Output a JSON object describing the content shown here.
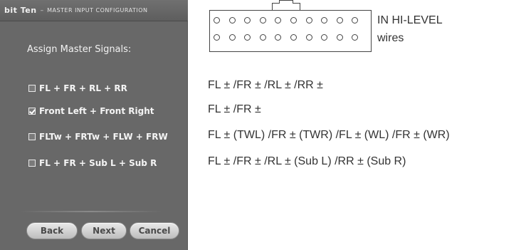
{
  "window": {
    "brand": "bit Ten",
    "separator": "–",
    "subtitle": "Master Input Configuration"
  },
  "panel": {
    "heading": "Assign Master Signals:",
    "options": [
      {
        "label": "FL + FR + RL + RR",
        "checked": false
      },
      {
        "label": "Front Left + Front Right",
        "checked": true
      },
      {
        "label": "FLTw + FRTw + FLW + FRW",
        "checked": false
      },
      {
        "label": "FL + FR + Sub L + Sub R",
        "checked": false
      }
    ],
    "buttons": {
      "back": "Back",
      "next": "Next",
      "cancel": "Cancel"
    }
  },
  "connector": {
    "label_line1": "IN HI-LEVEL",
    "label_line2": "wires"
  },
  "formulas": [
    "FL ± /FR ± /RL ± /RR ±",
    "FL ± /FR ±",
    "FL ± (TWL) /FR ± (TWR) /FL ± (WL) /FR ± (WR)",
    "FL ± /FR ± /RL ± (Sub L) /RR ± (Sub R)"
  ]
}
